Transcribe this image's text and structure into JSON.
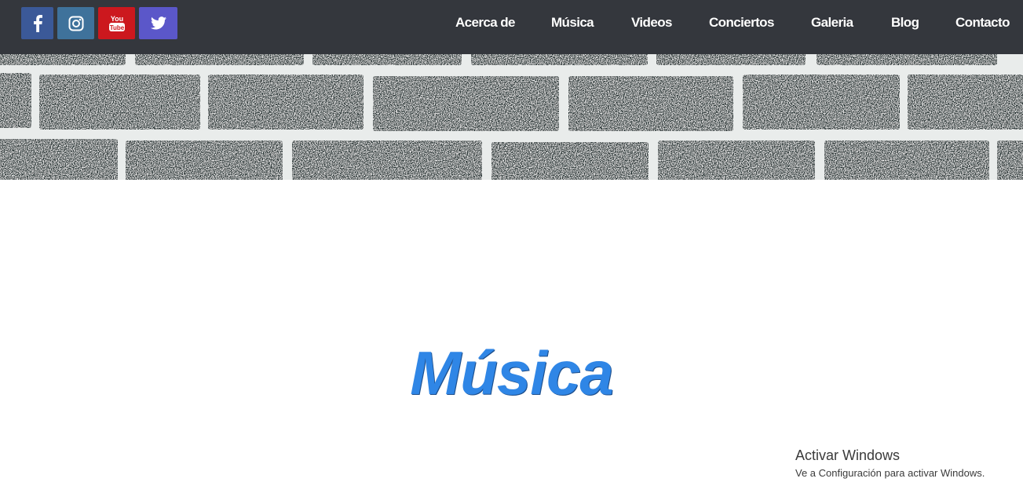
{
  "social": [
    {
      "name": "facebook",
      "icon": "facebook-icon",
      "color": "#3b5998"
    },
    {
      "name": "instagram",
      "icon": "instagram-icon",
      "color": "#3f729b"
    },
    {
      "name": "youtube",
      "icon": "youtube-icon",
      "color": "#cc181e",
      "label_top": "You",
      "label_bottom": "Tube"
    },
    {
      "name": "twitter",
      "icon": "twitter-icon",
      "color": "#5b57c9"
    }
  ],
  "nav": {
    "items": [
      {
        "label": "Acerca de"
      },
      {
        "label": "Música"
      },
      {
        "label": "Videos"
      },
      {
        "label": "Conciertos"
      },
      {
        "label": "Galeria"
      },
      {
        "label": "Blog"
      },
      {
        "label": "Contacto"
      }
    ]
  },
  "main": {
    "section_title": "Música"
  },
  "watermark": {
    "title": "Activar Windows",
    "subtitle": "Ve a Configuración para activar Windows."
  },
  "colors": {
    "topbar": "#34373d",
    "title": "#2f86e6"
  }
}
